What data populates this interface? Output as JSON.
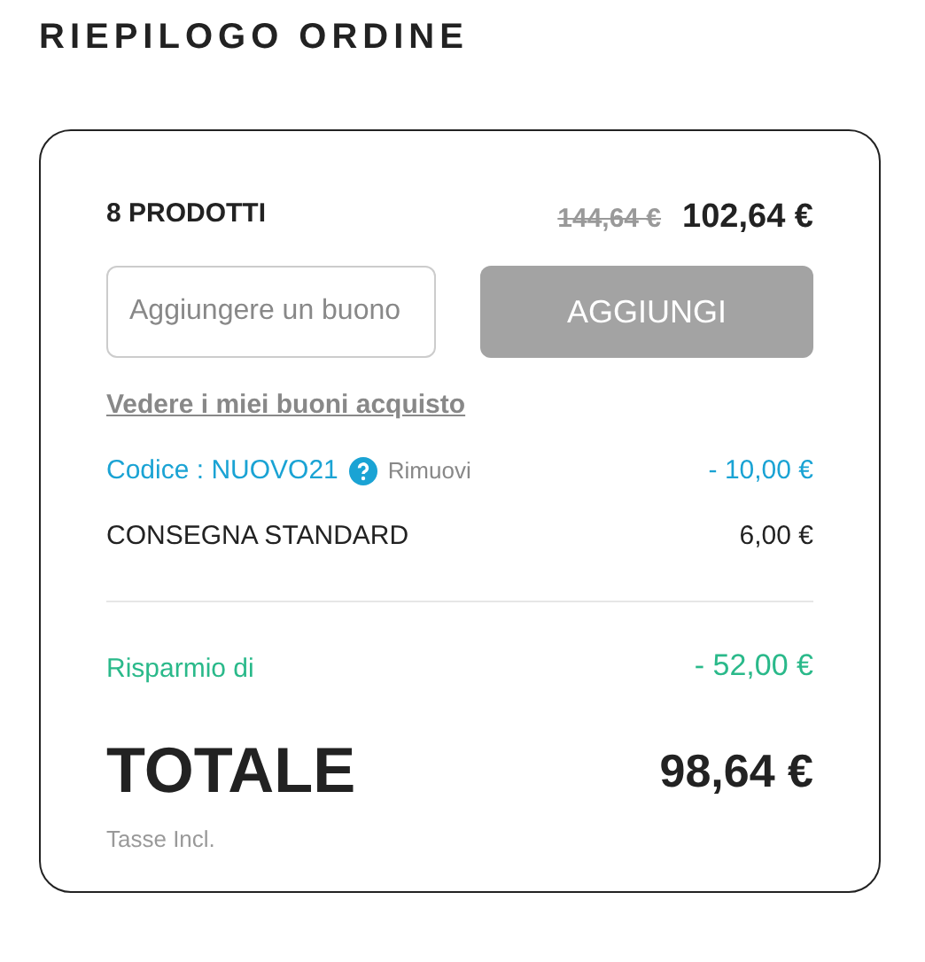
{
  "title": "RIEPILOGO ORDINE",
  "summary": {
    "count": "8 PRODOTTI",
    "old_price": "144,64 €",
    "price": "102,64 €"
  },
  "voucher": {
    "placeholder": "Aggiungere un buono",
    "button": {
      "label": "AGGIUNGI",
      "disabled": true
    },
    "link": "Vedere i miei buoni acquisto"
  },
  "lines": [
    {
      "kind": "code",
      "label": "Codice : NUOVO21",
      "action": "Rimuovi",
      "amount": "- 10,00 €"
    },
    {
      "kind": "plain",
      "label": "CONSEGNA STANDARD",
      "amount": "6,00 €"
    }
  ],
  "savings": {
    "label": "Risparmio di",
    "amount": "- 52,00 €"
  },
  "total": {
    "label": "TOTALE",
    "amount": "98,64 €",
    "note": "Tasse Incl."
  }
}
